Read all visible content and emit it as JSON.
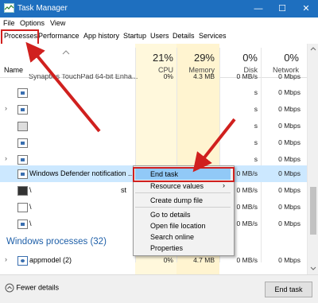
{
  "window": {
    "title": "Task Manager",
    "minimize": "—",
    "maximize": "☐",
    "close": "✕"
  },
  "menu": [
    "File",
    "Options",
    "View"
  ],
  "tabs": [
    "Processes",
    "Performance",
    "App history",
    "Startup",
    "Users",
    "Details",
    "Services"
  ],
  "header": {
    "cpu_pct": "21%",
    "memory_pct": "29%",
    "disk_pct": "0%",
    "network_pct": "0%",
    "name_label": "Name",
    "cpu_label": "CPU",
    "memory_label": "Memory",
    "disk_label": "Disk",
    "network_label": "Network"
  },
  "rows": [
    {
      "name": "Synaptics TouchPad 64-bit Enha...",
      "cpu": "0%",
      "memory": "4.3 MB",
      "disk": "0 MB/s",
      "network": "0 Mbps"
    },
    {
      "name": "",
      "cpu": "",
      "memory": "",
      "disk": "s",
      "network": "0 Mbps"
    },
    {
      "name": "",
      "cpu": "",
      "memory": "",
      "disk": "s",
      "network": "0 Mbps"
    },
    {
      "name": "",
      "cpu": "",
      "memory": "",
      "disk": "s",
      "network": "0 Mbps"
    },
    {
      "name": "",
      "cpu": "",
      "memory": "",
      "disk": "s",
      "network": "0 Mbps"
    },
    {
      "name": "",
      "cpu": "",
      "memory": "",
      "disk": "s",
      "network": "0 Mbps"
    },
    {
      "name": "Windows Defender notification ...",
      "cpu": "",
      "memory": "",
      "disk": "0 MB/s",
      "network": "0 Mbps"
    },
    {
      "name": "\\",
      "suffix": "st",
      "cpu": "",
      "memory": "",
      "disk": "0 MB/s",
      "network": "0 Mbps"
    },
    {
      "name": "\\",
      "cpu": "",
      "memory": "",
      "disk": "0 MB/s",
      "network": "0 Mbps"
    },
    {
      "name": "\\",
      "cpu": "",
      "memory": "",
      "disk": "0 MB/s",
      "network": "0 Mbps"
    }
  ],
  "section": {
    "title": "Windows processes (32)"
  },
  "appmodel": {
    "name": "appmodel (2)",
    "cpu": "0%",
    "memory": "4.7 MB",
    "disk": "0 MB/s",
    "network": "0 Mbps"
  },
  "context_menu": {
    "end_task": "End task",
    "resource_values": "Resource values",
    "create_dump": "Create dump file",
    "go_to_details": "Go to details",
    "open_file_location": "Open file location",
    "search_online": "Search online",
    "properties": "Properties"
  },
  "footer": {
    "fewer_details": "Fewer details",
    "end_task": "End task"
  },
  "colors": {
    "titlebar": "#1e6fbf",
    "highlight": "#cce8ff",
    "annotation": "#d0201e",
    "section_title": "#1e5fa8"
  }
}
